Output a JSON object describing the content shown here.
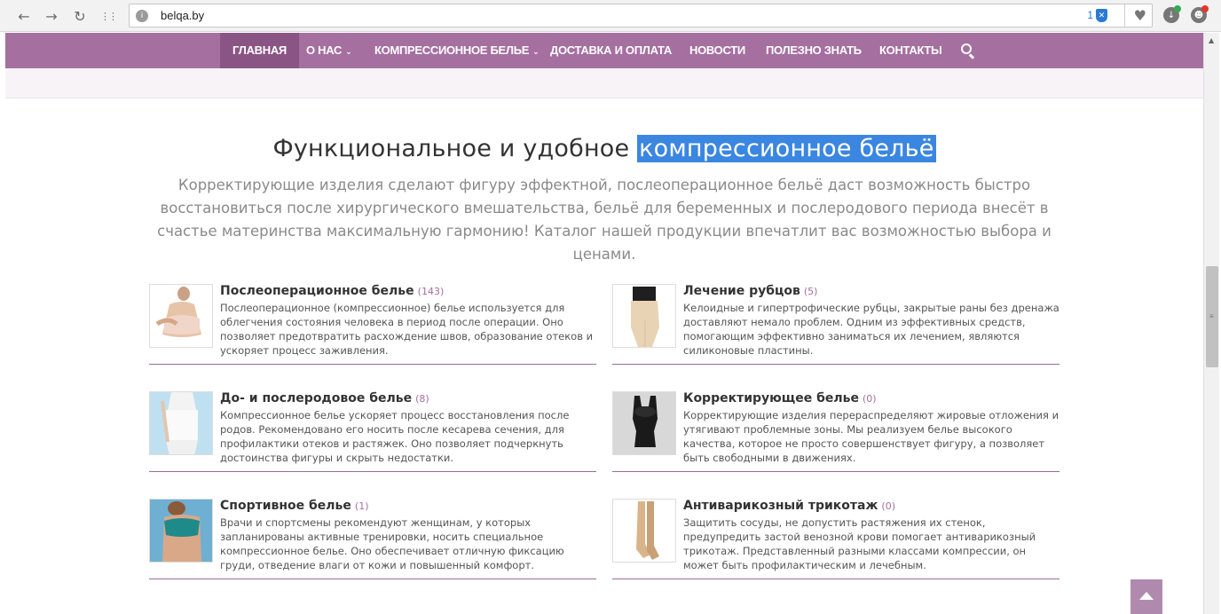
{
  "browser": {
    "url": "belqa.by",
    "badge_count": "1",
    "back_icon": "←",
    "forward_icon": "→",
    "reload_icon": "↻",
    "apps_icon": "⋮⋮"
  },
  "nav": {
    "items": [
      {
        "label": "ГЛАВНАЯ"
      },
      {
        "label": "О НАС"
      },
      {
        "label": "КОМПРЕССИОННОЕ БЕЛЬЕ"
      },
      {
        "label": "ДОСТАВКА И ОПЛАТА"
      },
      {
        "label": "НОВОСТИ"
      },
      {
        "label": "ПОЛЕЗНО ЗНАТЬ"
      },
      {
        "label": "КОНТАКТЫ"
      }
    ],
    "active_index": 0
  },
  "hero": {
    "title_plain": "Функциональное и удобное ",
    "title_highlight": "компрессионное бельё ",
    "intro": "Корректирующие изделия сделают фигуру эффектной, послеоперационное бельё даст возможность быстро восстановиться после хирургического вмешательства, бельё для беременных и послеродового периода внесёт в счастье материнства максимальную гармонию! Каталог нашей продукции впечатлит вас возможностью выбора и ценами."
  },
  "categories": [
    {
      "title": "Послеоперационное белье",
      "count": "(143)",
      "description": "Послеоперационное (компрессионное) белье используется для облегчения состояния человека в период после операции. Оно позволяет предотвратить расхождение швов, образование отеков и ускоряет процесс заживления."
    },
    {
      "title": "Лечение рубцов",
      "count": "(5)",
      "description": "Келоидные и гипертрофические рубцы, закрытые раны без дренажа доставляют немало проблем. Одним из эффективных средств, помогающим эффективно заниматься их лечением, являются силиконовые пластины."
    },
    {
      "title": "До- и послеродовое белье",
      "count": "(8)",
      "description": "Компрессионное белье ускоряет процесс восстановления после родов. Рекомендовано его носить после кесарева сечения, для профилактики отеков и растяжек. Оно позволяет подчеркнуть достоинства фигуры и скрыть недостатки."
    },
    {
      "title": "Корректирующее белье",
      "count": "(0)",
      "description": "Корректирующие изделия перераспределяют жировые отложения и утягивают проблемные зоны. Мы реализуем белье высокого качества, которое не просто совершенствует фигуру, а позволяет быть свободными в движениях."
    },
    {
      "title": "Спортивное белье",
      "count": "(1)",
      "description": "Врачи и спортсмены рекомендуют женщинам, у которых запланированы активные тренировки, носить специальное компрессионное белье. Оно обеспечивает отличную фиксацию груди, отведение влаги от кожи и повышенный комфорт."
    },
    {
      "title": "Антиварикозный трикотаж",
      "count": "(0)",
      "description": "Защитить сосуды, не допустить растяжения их стенок, предупредить застой венозной крови помогает антиварикозный трикотаж. Представленный разными классами компрессии, он может быть профилактическим и лечебным."
    }
  ],
  "colors": {
    "nav_bg": "#a56fa0",
    "nav_active": "#8a5585",
    "highlight": "#3a86e0",
    "card_rule": "#9e6c99"
  }
}
